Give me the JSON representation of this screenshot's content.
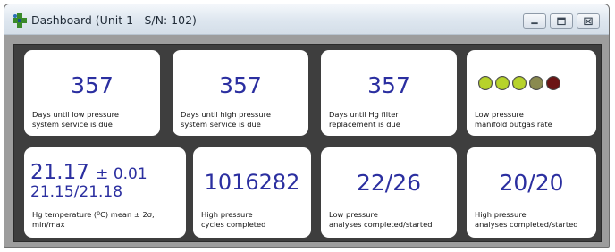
{
  "window": {
    "title": "Dashboard (Unit 1 - S/N: 102)"
  },
  "cards": {
    "low_pressure_service": {
      "value": "357",
      "label_line1": "Days until low pressure",
      "label_line2": "system service is due"
    },
    "high_pressure_service": {
      "value": "357",
      "label_line1": "Days until high pressure",
      "label_line2": "system service is due"
    },
    "hg_filter": {
      "value": "357",
      "label_line1": "Days until Hg filter",
      "label_line2": "replacement is due"
    },
    "outgas_rate": {
      "label_line1": "Low pressure",
      "label_line2": "manifold outgas rate",
      "indicator_colors": [
        "#b7d32a",
        "#b7d32a",
        "#b7d32a",
        "#8a8a50",
        "#6b1414"
      ]
    },
    "hg_temperature": {
      "mean": "21.17",
      "pm": "± 0.01",
      "minmax": "21.15/21.18",
      "label_line1": "Hg temperature (ºC) mean ± 2σ,",
      "label_line2": "min/max"
    },
    "high_pressure_cycles": {
      "value": "1016282",
      "label_line1": "High pressure",
      "label_line2": "cycles completed"
    },
    "low_pressure_analyses": {
      "value": "22/26",
      "label_line1": "Low pressure",
      "label_line2": "analyses completed/started"
    },
    "high_pressure_analyses": {
      "value": "20/20",
      "label_line1": "High pressure",
      "label_line2": "analyses completed/started"
    }
  },
  "colors": {
    "value_text": "#2b2fa0",
    "panel_background": "#3e3e3e",
    "card_background": "#ffffff"
  }
}
